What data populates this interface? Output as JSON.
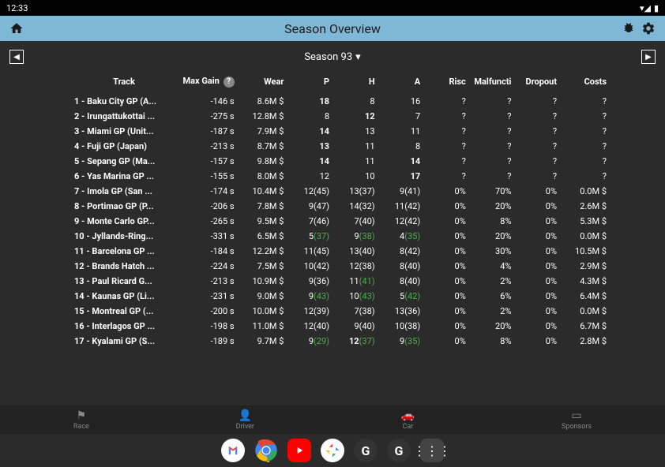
{
  "status": {
    "time": "12:33"
  },
  "header": {
    "title": "Season Overview"
  },
  "season": {
    "label": "Season 93"
  },
  "columns": [
    "Track",
    "Max Gain",
    "Wear",
    "P",
    "H",
    "A",
    "Risc",
    "Malfuncti",
    "Dropout",
    "Costs"
  ],
  "rows": [
    {
      "track": "1 - Baku City GP (A...",
      "maxgain": "-146 s",
      "wear": "8.6M $",
      "p": {
        "v": "18",
        "b": true
      },
      "h": {
        "v": "8"
      },
      "a": {
        "v": "16"
      },
      "risc": "?",
      "malf": "?",
      "drop": "?",
      "costs": "?"
    },
    {
      "track": "2 - Irungattukottai ...",
      "maxgain": "-275 s",
      "wear": "12.8M $",
      "p": {
        "v": "8"
      },
      "h": {
        "v": "12",
        "b": true
      },
      "a": {
        "v": "7"
      },
      "risc": "?",
      "malf": "?",
      "drop": "?",
      "costs": "?"
    },
    {
      "track": "3 - Miami GP (Unit...",
      "maxgain": "-187 s",
      "wear": "7.9M $",
      "p": {
        "v": "14",
        "b": true
      },
      "h": {
        "v": "13"
      },
      "a": {
        "v": "11"
      },
      "risc": "?",
      "malf": "?",
      "drop": "?",
      "costs": "?"
    },
    {
      "track": "4 - Fuji GP (Japan)",
      "maxgain": "-213 s",
      "wear": "8.7M $",
      "p": {
        "v": "13",
        "b": true
      },
      "h": {
        "v": "11"
      },
      "a": {
        "v": "8"
      },
      "risc": "?",
      "malf": "?",
      "drop": "?",
      "costs": "?"
    },
    {
      "track": "5 - Sepang GP (Ma...",
      "maxgain": "-157 s",
      "wear": "9.8M $",
      "p": {
        "v": "14",
        "b": true
      },
      "h": {
        "v": "11"
      },
      "a": {
        "v": "14",
        "b": true
      },
      "risc": "?",
      "malf": "?",
      "drop": "?",
      "costs": "?"
    },
    {
      "track": "6 - Yas Marina GP ...",
      "maxgain": "-155 s",
      "wear": "8.0M $",
      "p": {
        "v": "12"
      },
      "h": {
        "v": "10"
      },
      "a": {
        "v": "17",
        "b": true
      },
      "risc": "?",
      "malf": "?",
      "drop": "?",
      "costs": "?"
    },
    {
      "track": "7 - Imola GP (San ...",
      "maxgain": "-174 s",
      "wear": "10.4M $",
      "p": {
        "v": "12",
        "s": "(45)"
      },
      "h": {
        "v": "13",
        "s": "(37)"
      },
      "a": {
        "v": "9",
        "s": "(41)"
      },
      "risc": "0%",
      "malf": "70%",
      "drop": "0%",
      "costs": "0.0M $"
    },
    {
      "track": "8 - Portimao GP (P...",
      "maxgain": "-206 s",
      "wear": "7.8M $",
      "p": {
        "v": "9",
        "s": "(47)"
      },
      "h": {
        "v": "14",
        "s": "(32)"
      },
      "a": {
        "v": "11",
        "s": "(42)"
      },
      "risc": "0%",
      "malf": "20%",
      "drop": "0%",
      "costs": "2.6M $"
    },
    {
      "track": "9 - Monte Carlo GP...",
      "maxgain": "-265 s",
      "wear": "9.5M $",
      "p": {
        "v": "7",
        "s": "(46)"
      },
      "h": {
        "v": "7",
        "s": "(40)"
      },
      "a": {
        "v": "12",
        "s": "(42)"
      },
      "risc": "0%",
      "malf": "8%",
      "drop": "0%",
      "costs": "5.3M $"
    },
    {
      "track": "10 - Jyllands-Ring...",
      "maxgain": "-331 s",
      "wear": "6.5M $",
      "p": {
        "v": "5",
        "s": "(37)",
        "g": true
      },
      "h": {
        "v": "9",
        "s": "(38)",
        "g": true
      },
      "a": {
        "v": "4",
        "s": "(35)",
        "g": true
      },
      "risc": "0%",
      "malf": "20%",
      "drop": "0%",
      "costs": "0.0M $"
    },
    {
      "track": "11 - Barcelona GP ...",
      "maxgain": "-184 s",
      "wear": "12.2M $",
      "p": {
        "v": "11",
        "s": "(45)"
      },
      "h": {
        "v": "13",
        "s": "(40)"
      },
      "a": {
        "v": "8",
        "s": "(42)"
      },
      "risc": "0%",
      "malf": "30%",
      "drop": "0%",
      "costs": "10.5M $"
    },
    {
      "track": "12 - Brands Hatch ...",
      "maxgain": "-224 s",
      "wear": "7.5M $",
      "p": {
        "v": "10",
        "s": "(42)"
      },
      "h": {
        "v": "12",
        "s": "(38)"
      },
      "a": {
        "v": "8",
        "s": "(40)"
      },
      "risc": "0%",
      "malf": "4%",
      "drop": "0%",
      "costs": "2.9M $"
    },
    {
      "track": "13 - Paul Ricard G...",
      "maxgain": "-213 s",
      "wear": "10.9M $",
      "p": {
        "v": "9",
        "s": "(36)"
      },
      "h": {
        "v": "11",
        "s": "(41)",
        "g": true
      },
      "a": {
        "v": "8",
        "s": "(40)"
      },
      "risc": "0%",
      "malf": "2%",
      "drop": "0%",
      "costs": "4.3M $"
    },
    {
      "track": "14 - Kaunas GP (Li...",
      "maxgain": "-231 s",
      "wear": "9.0M $",
      "p": {
        "v": "9",
        "s": "(43)",
        "g": true
      },
      "h": {
        "v": "10",
        "s": "(43)",
        "g": true
      },
      "a": {
        "v": "5",
        "s": "(42)",
        "g": true
      },
      "risc": "0%",
      "malf": "6%",
      "drop": "0%",
      "costs": "6.4M $"
    },
    {
      "track": "15 - Montreal GP (...",
      "maxgain": "-200 s",
      "wear": "10.0M $",
      "p": {
        "v": "12",
        "s": "(39)"
      },
      "h": {
        "v": "7",
        "s": "(38)"
      },
      "a": {
        "v": "13",
        "s": "(36)"
      },
      "risc": "0%",
      "malf": "2%",
      "drop": "0%",
      "costs": "0.0M $"
    },
    {
      "track": "16 - Interlagos GP ...",
      "maxgain": "-198 s",
      "wear": "11.0M $",
      "p": {
        "v": "12",
        "s": "(40)"
      },
      "h": {
        "v": "9",
        "s": "(40)"
      },
      "a": {
        "v": "10",
        "s": "(38)"
      },
      "risc": "0%",
      "malf": "20%",
      "drop": "0%",
      "costs": "6.7M $"
    },
    {
      "track": "17 - Kyalami GP (S...",
      "maxgain": "-189 s",
      "wear": "9.7M $",
      "p": {
        "v": "9",
        "s": "(29)",
        "g": true
      },
      "h": {
        "v": "12",
        "s": "(37)",
        "g": true,
        "b": true
      },
      "a": {
        "v": "9",
        "s": "(35)",
        "g": true
      },
      "risc": "0%",
      "malf": "8%",
      "drop": "0%",
      "costs": "2.8M $"
    }
  ],
  "nav": {
    "race": "Race",
    "driver": "Driver",
    "car": "Car",
    "sponsors": "Sponsors"
  }
}
